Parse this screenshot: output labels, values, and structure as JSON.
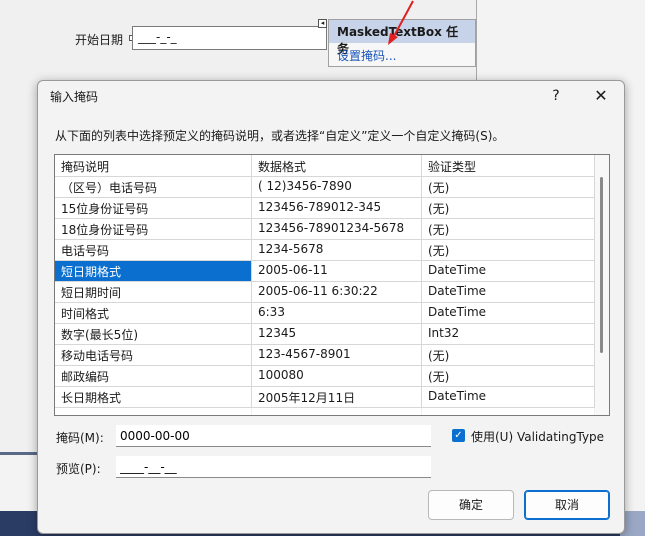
{
  "background": {
    "start_date_label": "开始日期",
    "masked_input_value": "___-_-_",
    "smart_tag_glyph": "◂",
    "tasks_panel": {
      "title": "MaskedTextBox 任务",
      "link": "设置掩码..."
    }
  },
  "dialog": {
    "title": "输入掩码",
    "help_glyph": "?",
    "close_glyph": "✕",
    "instruction": "从下面的列表中选择预定义的掩码说明，或者选择“自定义”定义一个自定义掩码(S)。",
    "columns": [
      "掩码说明",
      "数据格式",
      "验证类型"
    ],
    "rows": [
      [
        "（区号）电话号码",
        "( 12)3456-7890",
        "(无)"
      ],
      [
        "15位身份证号码",
        "123456-789012-345",
        "(无)"
      ],
      [
        "18位身份证号码",
        "123456-78901234-5678",
        "(无)"
      ],
      [
        "电话号码",
        "1234-5678",
        "(无)"
      ],
      [
        "短日期格式",
        "2005-06-11",
        "DateTime"
      ],
      [
        "短日期时间",
        "2005-06-11  6:30:22",
        "DateTime"
      ],
      [
        "时间格式",
        " 6:33",
        "DateTime"
      ],
      [
        "数字(最长5位)",
        "12345",
        "Int32"
      ],
      [
        "移动电话号码",
        "123-4567-8901",
        "(无)"
      ],
      [
        "邮政编码",
        "100080",
        "(无)"
      ],
      [
        "长日期格式",
        "2005年12月11日",
        "DateTime"
      ]
    ],
    "selected_row": 4,
    "mask_label": "掩码(M):",
    "mask_value": "0000-00-00",
    "preview_label": "预览(P):",
    "preview_value": "____-__-__",
    "use_validating_type_label": "使用(U) ValidatingType",
    "use_validating_type_checked": true,
    "checkmark_glyph": "✓",
    "ok_label": "确定",
    "cancel_label": "取消"
  },
  "colors": {
    "selection": "#0b6fcf",
    "tasks_header": "#c7d3e8",
    "link": "#1a55b8",
    "arrow": "#e02020"
  }
}
